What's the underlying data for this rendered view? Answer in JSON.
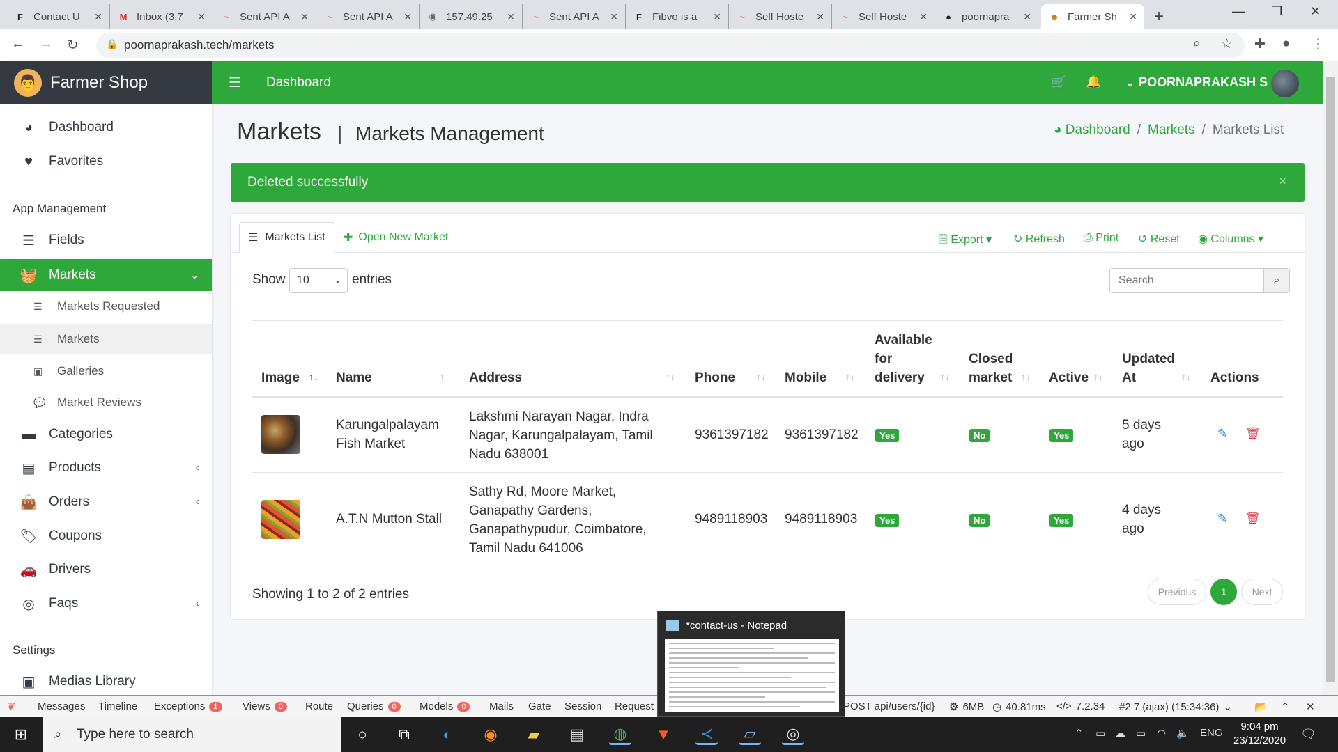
{
  "browser": {
    "tabs": [
      {
        "icon": "F",
        "title": "Contact U"
      },
      {
        "icon": "M",
        "title": "Inbox (3,7"
      },
      {
        "icon": "~",
        "title": "Sent API A"
      },
      {
        "icon": "~",
        "title": "Sent API A"
      },
      {
        "icon": "◉",
        "title": "157.49.25"
      },
      {
        "icon": "~",
        "title": "Sent API A"
      },
      {
        "icon": "F",
        "title": "Fibvo is a"
      },
      {
        "icon": "~",
        "title": "Self Hoste"
      },
      {
        "icon": "~",
        "title": "Self Hoste"
      },
      {
        "icon": "●",
        "title": "poornapra"
      },
      {
        "icon": "☻",
        "title": "Farmer Sh"
      }
    ],
    "url": "poornaprakash.tech/markets"
  },
  "sidebar": {
    "brand": "Farmer Shop",
    "items": [
      {
        "label": "Dashboard",
        "icon": "tachometer-icon"
      },
      {
        "label": "Favorites",
        "icon": "heart-icon"
      }
    ],
    "app_header": "App Management",
    "app_items": [
      {
        "label": "Fields",
        "icon": "list-icon"
      },
      {
        "label": "Markets",
        "icon": "basket-icon"
      }
    ],
    "sub_items": [
      {
        "label": "Markets Requested"
      },
      {
        "label": "Markets"
      },
      {
        "label": "Galleries"
      },
      {
        "label": "Market Reviews"
      }
    ],
    "more_items": [
      {
        "label": "Categories"
      },
      {
        "label": "Products"
      },
      {
        "label": "Orders"
      },
      {
        "label": "Coupons"
      },
      {
        "label": "Drivers"
      },
      {
        "label": "Faqs"
      }
    ],
    "settings_header": "Settings",
    "settings_items": [
      {
        "label": "Medias Library"
      }
    ]
  },
  "topnav": {
    "title": "Dashboard",
    "user": "POORNAPRAKASH S R"
  },
  "page": {
    "title": "Markets",
    "divider": "|",
    "subtitle": "Markets Management",
    "breadcrumb": [
      "Dashboard",
      "/",
      "Markets",
      "/",
      "Markets List"
    ]
  },
  "alert": {
    "message": "Deleted successfully",
    "close": "×"
  },
  "card": {
    "tab_list": "Markets List",
    "tab_new": "Open New Market",
    "tools": [
      "Export",
      "Refresh",
      "Print",
      "Reset",
      "Columns"
    ],
    "show": "Show",
    "length": "10",
    "entries": "entries",
    "search_placeholder": "Search",
    "columns": [
      "Image",
      "Name",
      "Address",
      "Phone",
      "Mobile",
      "Available for delivery",
      "Closed market",
      "Active",
      "Updated At",
      "Actions"
    ],
    "rows": [
      {
        "name": "Karungalpalayam Fish Market",
        "address": "Lakshmi Narayan Nagar, Indra Nagar, Karungalpalayam, Tamil Nadu 638001",
        "phone": "9361397182",
        "mobile": "9361397182",
        "delivery": "Yes",
        "closed": "No",
        "active": "Yes",
        "updated": "5 days ago"
      },
      {
        "name": "A.T.N Mutton Stall",
        "address": "Sathy Rd, Moore Market, Ganapathy Gardens, Ganapathypudur, Coimbatore, Tamil Nadu 641006",
        "phone": "9489118903",
        "mobile": "9489118903",
        "delivery": "Yes",
        "closed": "No",
        "active": "Yes",
        "updated": "4 days ago"
      }
    ],
    "showing": "Showing 1 to 2 of 2 entries",
    "pagination": {
      "prev": "Previous",
      "current": "1",
      "next": "Next"
    }
  },
  "debugbar": {
    "tabs": [
      {
        "label": "Messages"
      },
      {
        "label": "Timeline"
      },
      {
        "label": "Exceptions",
        "count": "1"
      },
      {
        "label": "Views",
        "count": "0"
      },
      {
        "label": "Route"
      },
      {
        "label": "Queries",
        "count": "0"
      },
      {
        "label": "Models",
        "count": "0"
      },
      {
        "label": "Mails"
      },
      {
        "label": "Gate"
      },
      {
        "label": "Session"
      },
      {
        "label": "Request"
      }
    ],
    "route": "POST api/users/{id}",
    "memory": "6MB",
    "time": "40.81ms",
    "php": "7.2.34",
    "request": "#2 7 (ajax) (15:34:36)"
  },
  "notepad": {
    "title": "*contact-us - Notepad"
  },
  "taskbar": {
    "search": "Type here to search",
    "lang": "ENG",
    "time": "9:04 pm",
    "date": "23/12/2020"
  },
  "colors": {
    "primary": "#2ea83a",
    "sidebar_dark": "#343a40",
    "danger": "#dc3545",
    "edit": "#1e88e5"
  }
}
